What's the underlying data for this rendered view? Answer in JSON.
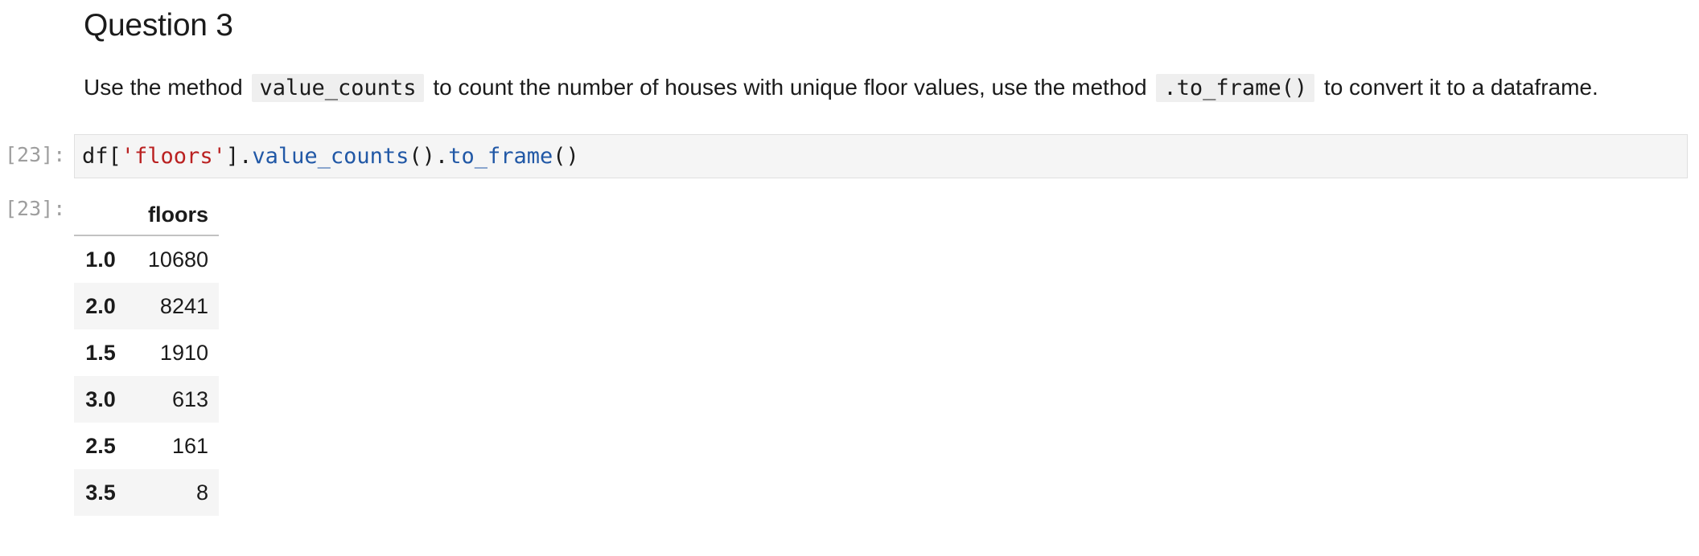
{
  "markdown": {
    "heading": "Question 3",
    "paragraph": {
      "text_1": "Use the method",
      "code_1": "value_counts",
      "text_2": "to count the number of houses with unique floor values, use the method",
      "code_2": ".to_frame()",
      "text_3": "to convert it to a dataframe."
    }
  },
  "input_cell": {
    "prompt": "[23]:",
    "code_tokens": [
      {
        "text": "df[",
        "kind": "plain"
      },
      {
        "text": "'floors'",
        "kind": "string"
      },
      {
        "text": "].",
        "kind": "plain"
      },
      {
        "text": "value_counts",
        "kind": "function"
      },
      {
        "text": "().",
        "kind": "plain"
      },
      {
        "text": "to_frame",
        "kind": "function"
      },
      {
        "text": "()",
        "kind": "plain"
      }
    ]
  },
  "output_cell": {
    "prompt": "[23]:",
    "table": {
      "column_header": "floors",
      "rows": [
        {
          "index": "1.0",
          "value": "10680"
        },
        {
          "index": "2.0",
          "value": "8241"
        },
        {
          "index": "1.5",
          "value": "1910"
        },
        {
          "index": "3.0",
          "value": "613"
        },
        {
          "index": "2.5",
          "value": "161"
        },
        {
          "index": "3.5",
          "value": "8"
        }
      ]
    }
  },
  "colors": {
    "string_token": "#ba2121",
    "function_token": "#2158a6",
    "prompt": "#9e9e9e",
    "code_background": "#f5f5f5"
  }
}
